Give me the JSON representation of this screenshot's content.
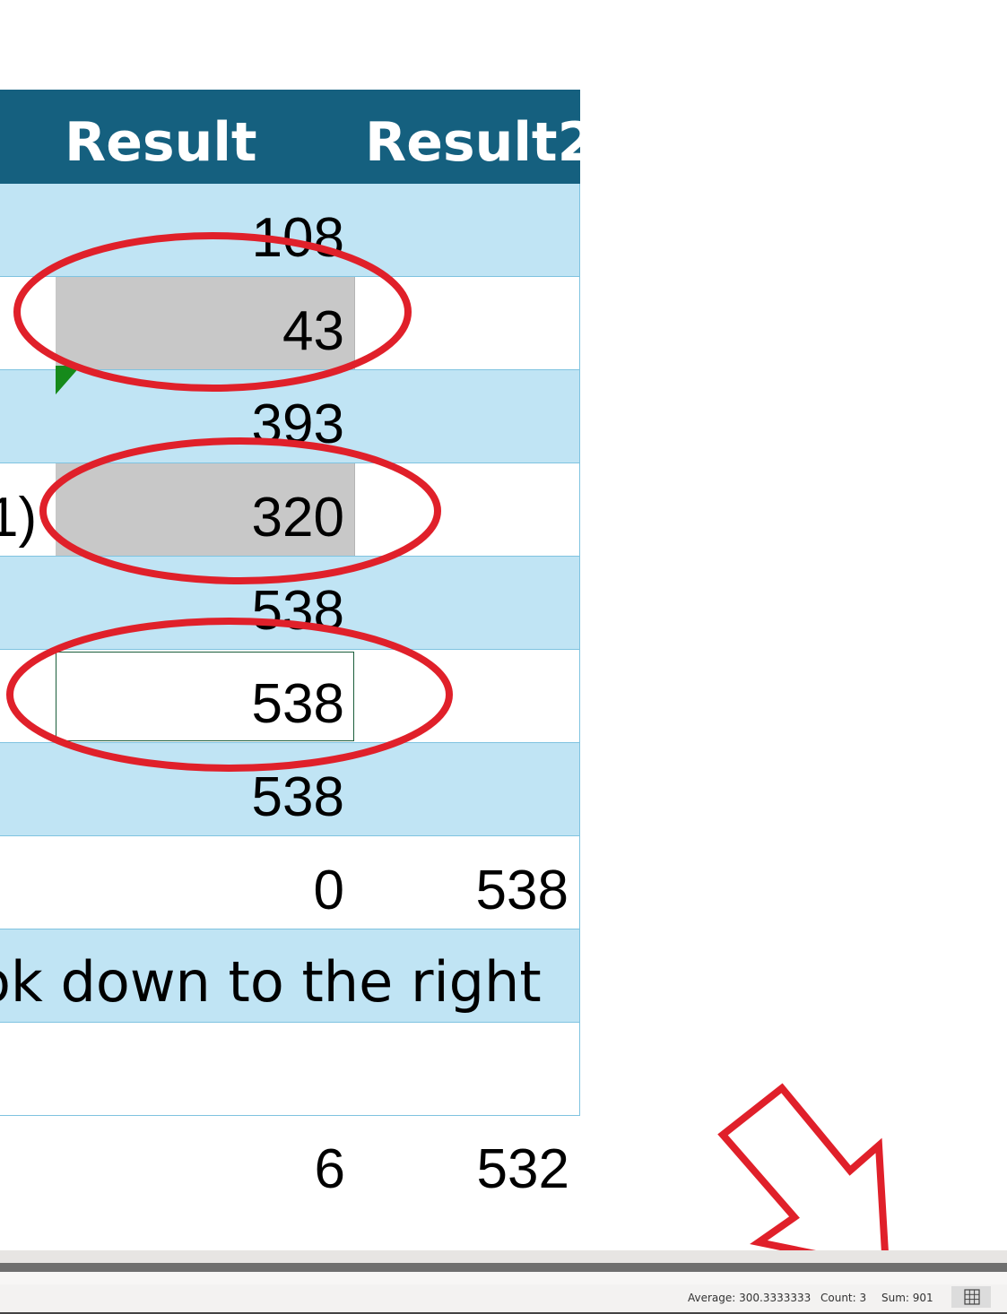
{
  "table": {
    "headers": [
      "Result",
      "Result2"
    ],
    "rows": [
      {
        "result": "108",
        "result2": ""
      },
      {
        "result": "43",
        "result2": ""
      },
      {
        "result": "393",
        "result2": ""
      },
      {
        "result": "320",
        "result2": "",
        "left_fragment": "1)"
      },
      {
        "result": "538",
        "result2": ""
      },
      {
        "result": "538",
        "result2": ""
      },
      {
        "result": "538",
        "result2": ""
      },
      {
        "result": "0",
        "result2": "538"
      },
      {
        "note": "ok down to the right"
      },
      {
        "result": "",
        "result2": ""
      }
    ],
    "below_row": {
      "result": "6",
      "result2": "532"
    }
  },
  "status_bar": {
    "average": "Average: 300.3333333",
    "count": "Count: 3",
    "sum": "Sum: 901"
  },
  "icons": {
    "error_indicator": "green-triangle-icon",
    "normal_view": "grid-view-icon"
  },
  "colors": {
    "header_bg": "#15607f",
    "band_bg": "#c0e4f4",
    "highlight_gray": "#c8c8c8",
    "annotation_red": "#e0202a"
  }
}
